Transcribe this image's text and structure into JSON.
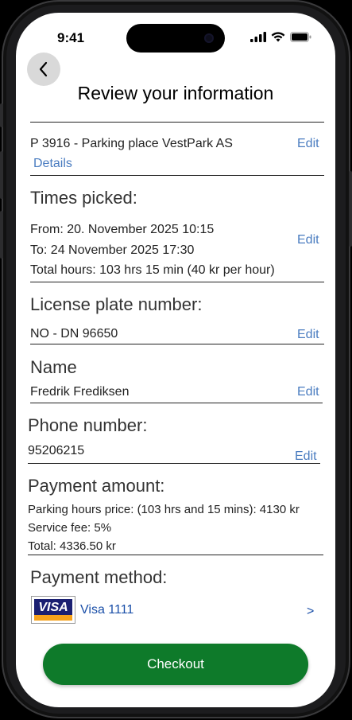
{
  "status_bar": {
    "time": "9:41"
  },
  "header": {
    "title": "Review your information"
  },
  "parking": {
    "place": "P 3916  -  Parking place VestPark AS",
    "details_link": "Details",
    "edit_label": "Edit"
  },
  "times": {
    "heading": "Times picked:",
    "from": "From: 20. November 2025 10:15",
    "to": "To: 24 November 2025 17:30",
    "total": "Total hours: 103 hrs 15 min (40 kr per hour)",
    "edit_label": "Edit"
  },
  "license": {
    "heading": "License plate number:",
    "value": "NO   -   DN 96650",
    "edit_label": "Edit"
  },
  "name": {
    "heading": "Name",
    "value": "Fredrik Frediksen",
    "edit_label": "Edit"
  },
  "phone": {
    "heading": "Phone number:",
    "value": "95206215",
    "edit_label": "Edit"
  },
  "payment_amount": {
    "heading": "Payment amount:",
    "hours_price": "Parking hours price: (103 hrs and 15 mins): 4130 kr",
    "service_fee": "Service fee: 5%",
    "total": "Total: 4336.50 kr"
  },
  "payment_method": {
    "heading": "Payment method:",
    "card_brand": "VISA",
    "card_label": "Visa 1111",
    "chevron": ">"
  },
  "checkout": {
    "label": "Checkout"
  },
  "colors": {
    "link": "#4a7cc0",
    "checkout_button": "#0e7a2a",
    "back_button_bg": "#d9d9d9"
  }
}
